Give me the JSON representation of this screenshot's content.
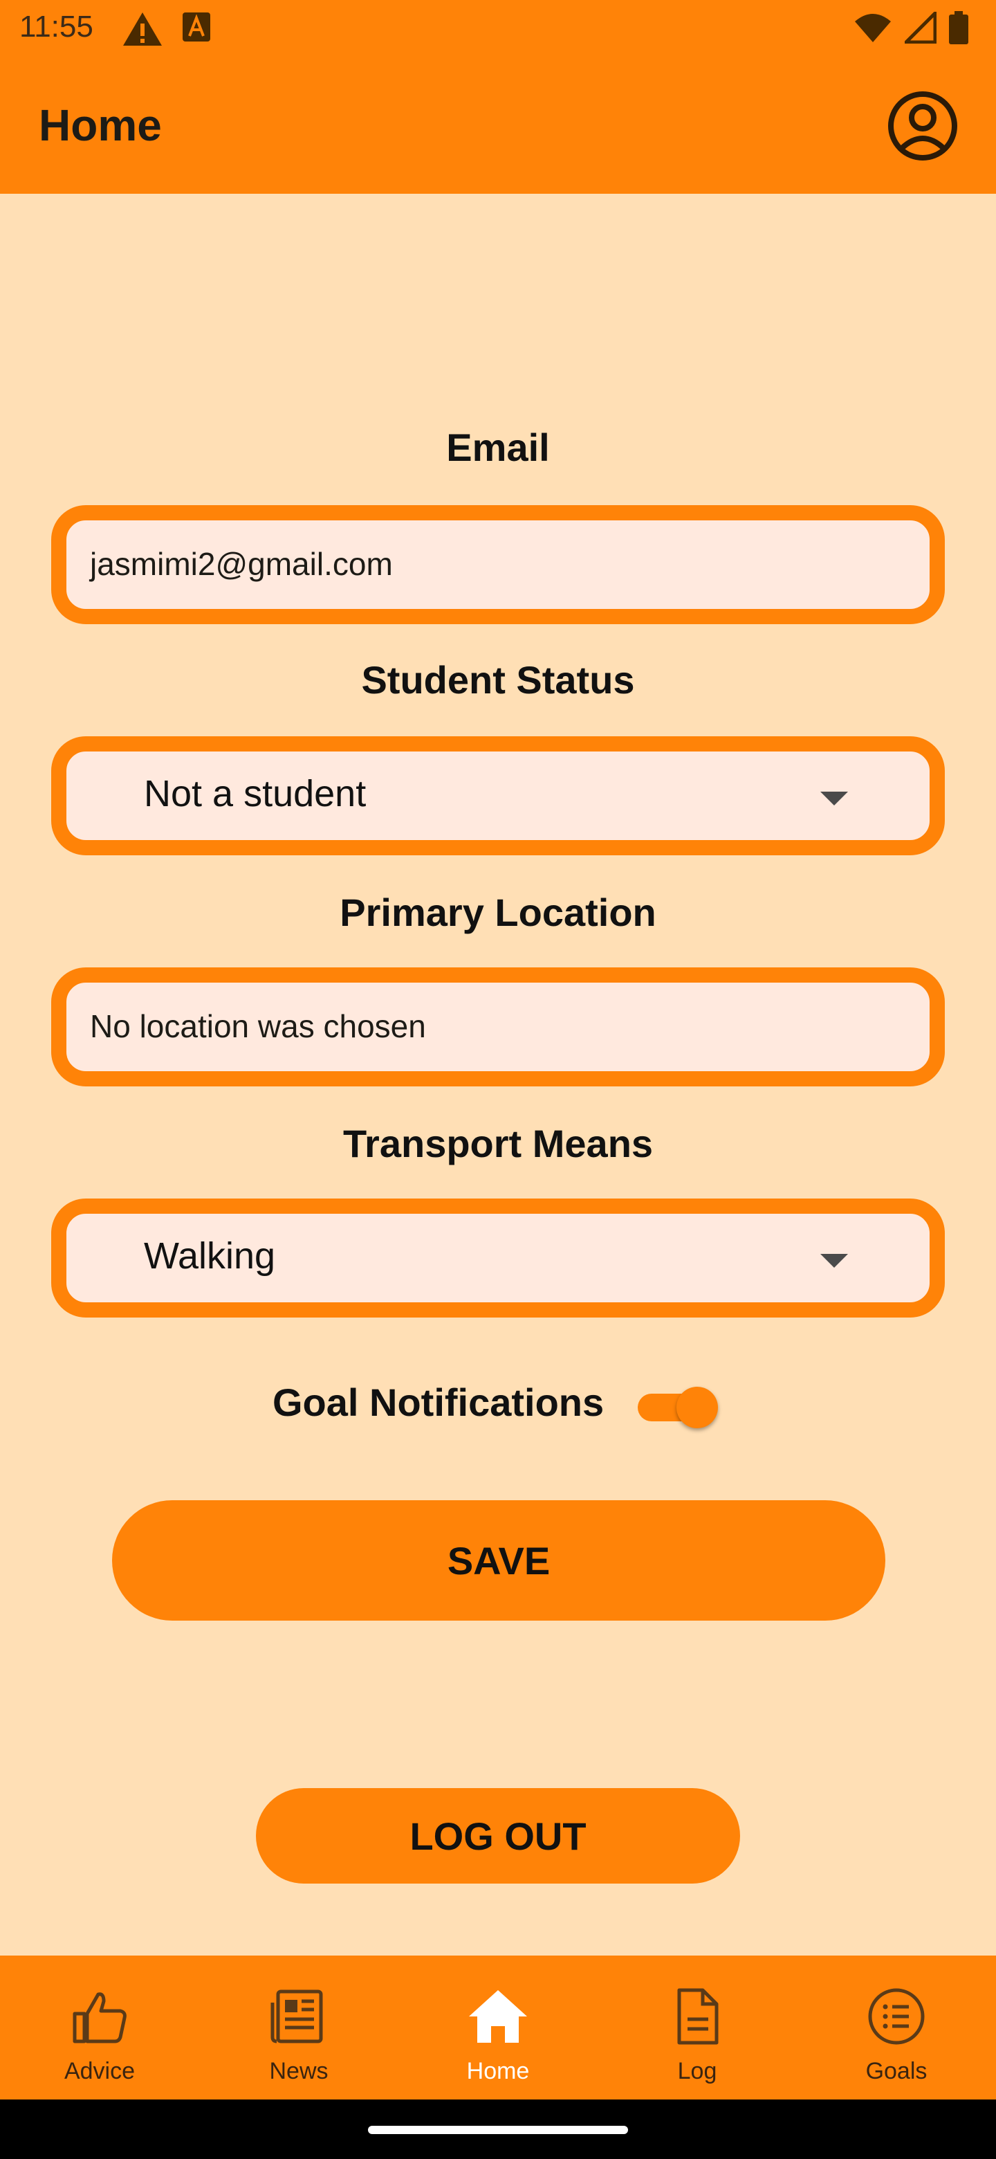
{
  "status_bar": {
    "time": "11:55",
    "left_icons": [
      "warning-icon",
      "text-a-icon"
    ],
    "right_icons": [
      "wifi-icon",
      "signal-icon",
      "battery-icon"
    ]
  },
  "app_bar": {
    "title": "Home",
    "profile_icon": "account-circle-icon"
  },
  "form": {
    "email": {
      "label": "Email",
      "value": "jasmimi2@gmail.com"
    },
    "student_status": {
      "label": "Student Status",
      "selected": "Not a student"
    },
    "primary_location": {
      "label": "Primary Location",
      "value": "No location was chosen"
    },
    "transport_means": {
      "label": "Transport Means",
      "selected": "Walking"
    },
    "goal_notifications": {
      "label": "Goal Notifications",
      "enabled": true
    }
  },
  "buttons": {
    "save": "SAVE",
    "logout": "LOG OUT"
  },
  "bottom_nav": {
    "items": [
      {
        "label": "Advice",
        "icon": "thumbs-up-icon",
        "active": false
      },
      {
        "label": "News",
        "icon": "newspaper-icon",
        "active": false
      },
      {
        "label": "Home",
        "icon": "home-icon",
        "active": true
      },
      {
        "label": "Log",
        "icon": "document-icon",
        "active": false
      },
      {
        "label": "Goals",
        "icon": "list-circle-icon",
        "active": false
      }
    ]
  },
  "colors": {
    "accent": "#FF8308",
    "background": "#FFDFB5",
    "field_fill": "#FFE9DE",
    "active_nav_text": "#FFFFFF"
  }
}
